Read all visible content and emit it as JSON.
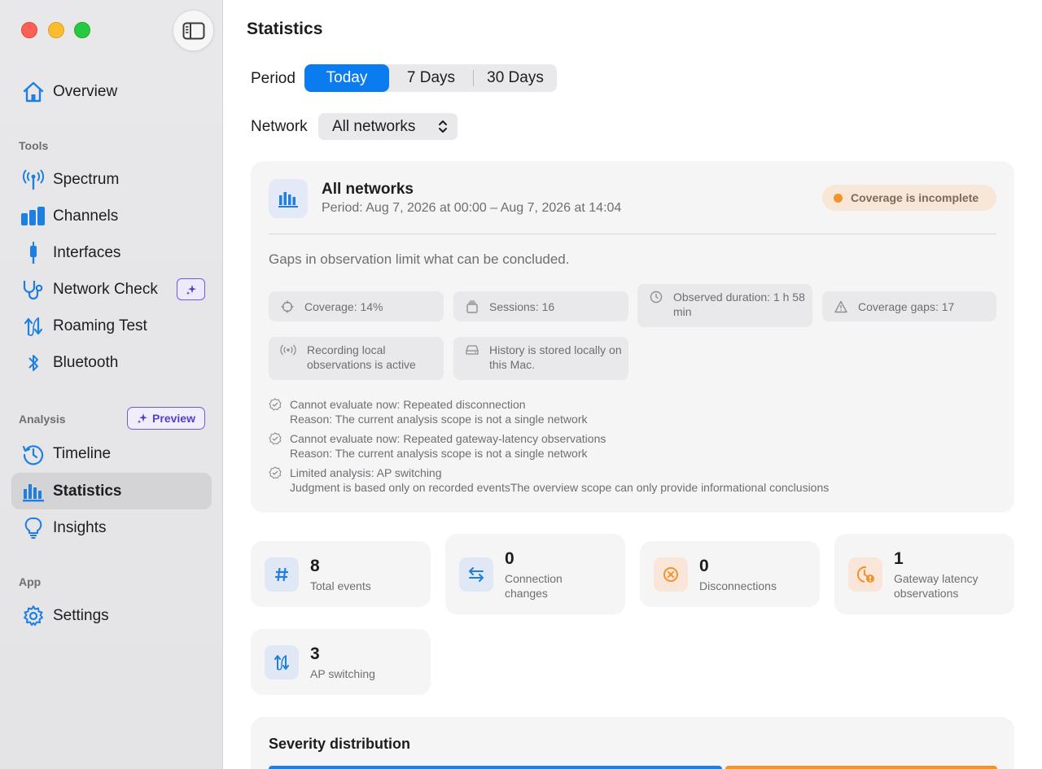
{
  "window": {
    "title": "Statistics"
  },
  "sidebar": {
    "items_top": [
      {
        "label": "Overview",
        "icon": "house-icon"
      }
    ],
    "sections": {
      "tools": "Tools",
      "analysis": "Analysis",
      "app": "App"
    },
    "tools": [
      {
        "label": "Spectrum",
        "icon": "antenna-icon"
      },
      {
        "label": "Channels",
        "icon": "bars-icon"
      },
      {
        "label": "Interfaces",
        "icon": "connector-icon"
      },
      {
        "label": "Network Check",
        "icon": "stethoscope-icon"
      },
      {
        "label": "Roaming Test",
        "icon": "roaming-arrows-icon"
      },
      {
        "label": "Bluetooth",
        "icon": "bluetooth-icon"
      }
    ],
    "analysis": [
      {
        "label": "Timeline",
        "icon": "history-clock-icon"
      },
      {
        "label": "Statistics",
        "icon": "chart-bars-icon",
        "active": true
      },
      {
        "label": "Insights",
        "icon": "lightbulb-icon"
      }
    ],
    "preview_label": "Preview",
    "app": [
      {
        "label": "Settings",
        "icon": "gear-icon"
      }
    ]
  },
  "main": {
    "title": "Statistics",
    "period_label": "Period",
    "periods": [
      "Today",
      "7 Days",
      "30 Days"
    ],
    "selected_period": "Today",
    "network_label": "Network",
    "network_value": "All networks"
  },
  "summary": {
    "title": "All networks",
    "period": "Period: Aug 7, 2026 at 00:00 – Aug 7, 2026 at 14:04",
    "coverage_badge": "Coverage is incomplete",
    "gaps_text": "Gaps in observation limit what can be concluded.",
    "chips": [
      "Coverage: 14%",
      "Sessions: 16",
      "Observed duration: 1 h 58 min",
      "Coverage gaps: 17",
      "Recording local observations is active",
      "History is stored locally on this Mac."
    ],
    "notes": [
      {
        "line1": "Cannot evaluate now: Repeated disconnection",
        "line2": "Reason: The current analysis scope is not a single network"
      },
      {
        "line1": "Cannot evaluate now: Repeated gateway-latency observations",
        "line2": "Reason: The current analysis scope is not a single network"
      },
      {
        "line1": "Limited analysis: AP switching",
        "line2": "Judgment is based only on recorded eventsThe overview scope can only provide informational conclusions"
      }
    ]
  },
  "stats": [
    {
      "value": "8",
      "caption": "Total events",
      "icon": "hash-icon"
    },
    {
      "value": "0",
      "caption": "Connection changes",
      "icon": "swap-arrows-icon"
    },
    {
      "value": "0",
      "caption": "Disconnections",
      "icon": "x-circle-icon"
    },
    {
      "value": "1",
      "caption": "Gateway latency observations",
      "icon": "clock-alert-icon"
    },
    {
      "value": "3",
      "caption": "AP switching",
      "icon": "roaming-arrows-icon"
    }
  ],
  "severity": {
    "title": "Severity distribution"
  },
  "colors": {
    "accent": "#0a7cf0",
    "warning": "#f3932c",
    "purple": "#6c5ce0"
  }
}
